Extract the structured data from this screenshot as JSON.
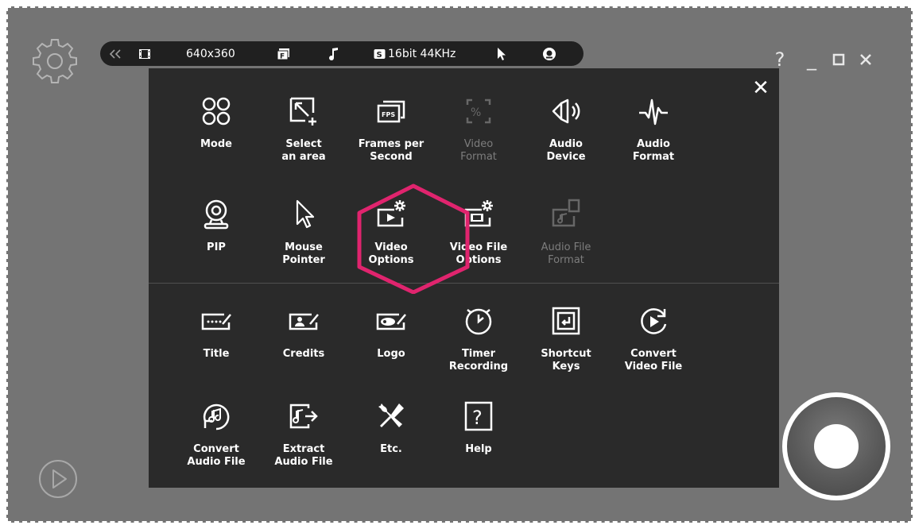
{
  "toolbar": {
    "resolution": "640x360",
    "audio_quality": "16bit 44KHz"
  },
  "window_controls": {
    "help": "?",
    "minimize": "_",
    "maximize": "☐",
    "close": "✕"
  },
  "menu": {
    "close": "✕",
    "items": [
      {
        "label": "Mode",
        "icon": "mode-icon",
        "enabled": true
      },
      {
        "label": "Select\nan area",
        "icon": "select-area-icon",
        "enabled": true
      },
      {
        "label": "Frames per\nSecond",
        "icon": "fps-icon",
        "enabled": true
      },
      {
        "label": "Video\nFormat",
        "icon": "video-format-icon",
        "enabled": false
      },
      {
        "label": "Audio\nDevice",
        "icon": "speaker-icon",
        "enabled": true
      },
      {
        "label": "Audio\nFormat",
        "icon": "waveform-icon",
        "enabled": true
      },
      {
        "label": "PIP",
        "icon": "webcam-icon",
        "enabled": true
      },
      {
        "label": "Mouse\nPointer",
        "icon": "cursor-icon",
        "enabled": true
      },
      {
        "label": "Video\nOptions",
        "icon": "video-settings-icon",
        "enabled": true
      },
      {
        "label": "Video File\nOptions",
        "icon": "video-file-settings-icon",
        "enabled": true
      },
      {
        "label": "Audio File\nFormat",
        "icon": "audio-file-icon",
        "enabled": false
      },
      {
        "label": "Title",
        "icon": "title-icon",
        "enabled": true
      },
      {
        "label": "Credits",
        "icon": "credits-icon",
        "enabled": true
      },
      {
        "label": "Logo",
        "icon": "logo-icon",
        "enabled": true
      },
      {
        "label": "Timer\nRecording",
        "icon": "timer-icon",
        "enabled": true
      },
      {
        "label": "Shortcut\nKeys",
        "icon": "shortcut-icon",
        "enabled": true
      },
      {
        "label": "Convert\nVideo File",
        "icon": "convert-video-icon",
        "enabled": true
      },
      {
        "label": "Convert\nAudio File",
        "icon": "convert-audio-icon",
        "enabled": true
      },
      {
        "label": "Extract\nAudio File",
        "icon": "extract-audio-icon",
        "enabled": true
      },
      {
        "label": "Etc.",
        "icon": "tools-icon",
        "enabled": true
      },
      {
        "label": "Help",
        "icon": "help-icon",
        "enabled": true
      }
    ]
  },
  "highlight": {
    "target": "Video Options",
    "color": "#e0246e"
  }
}
